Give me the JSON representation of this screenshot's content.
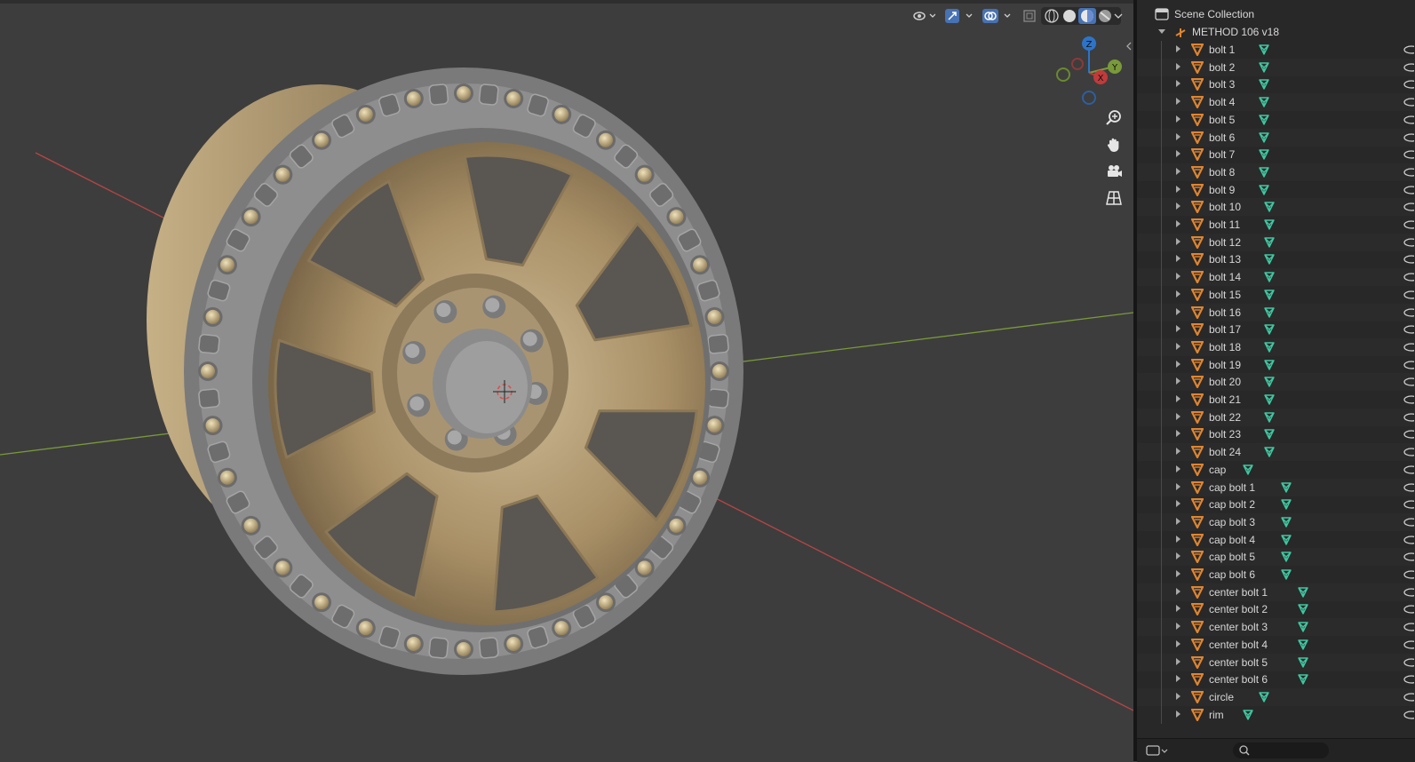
{
  "outliner": {
    "scene_collection_label": "Scene Collection",
    "collection_label": "METHOD 106 v18",
    "items": [
      {
        "label": "bolt 1"
      },
      {
        "label": "bolt 2"
      },
      {
        "label": "bolt 3"
      },
      {
        "label": "bolt 4"
      },
      {
        "label": "bolt 5"
      },
      {
        "label": "bolt 6"
      },
      {
        "label": "bolt 7"
      },
      {
        "label": "bolt 8"
      },
      {
        "label": "bolt 9"
      },
      {
        "label": "bolt 10"
      },
      {
        "label": "bolt 11"
      },
      {
        "label": "bolt 12"
      },
      {
        "label": "bolt 13"
      },
      {
        "label": "bolt 14"
      },
      {
        "label": "bolt 15"
      },
      {
        "label": "bolt 16"
      },
      {
        "label": "bolt 17"
      },
      {
        "label": "bolt 18"
      },
      {
        "label": "bolt 19"
      },
      {
        "label": "bolt 20"
      },
      {
        "label": "bolt 21"
      },
      {
        "label": "bolt 22"
      },
      {
        "label": "bolt 23"
      },
      {
        "label": "bolt 24"
      },
      {
        "label": "cap"
      },
      {
        "label": "cap bolt 1"
      },
      {
        "label": "cap bolt 2"
      },
      {
        "label": "cap bolt 3"
      },
      {
        "label": "cap bolt 4"
      },
      {
        "label": "cap bolt 5"
      },
      {
        "label": "cap bolt 6"
      },
      {
        "label": "center bolt 1"
      },
      {
        "label": "center bolt 2"
      },
      {
        "label": "center bolt 3"
      },
      {
        "label": "center bolt 4"
      },
      {
        "label": "center bolt 5"
      },
      {
        "label": "center bolt 6"
      },
      {
        "label": "circle"
      },
      {
        "label": "rim"
      }
    ]
  },
  "viewport": {
    "gizmo": {
      "z_label": "Z",
      "y_label": "Y",
      "x_label": "X"
    },
    "header_icons": [
      "visibility-icon",
      "gizmo-icon",
      "overlay-icon",
      "xray-icon",
      "wireframe-shading-icon",
      "solid-shading-icon",
      "material-shading-icon",
      "rendered-shading-icon"
    ],
    "nav_icons": [
      "zoom-icon",
      "pan-hand-icon",
      "camera-icon",
      "grid-ortho-icon"
    ]
  },
  "colors": {
    "viewport_bg": "#3d3d3d",
    "outliner_bg": "#282828",
    "object_orange": "#e0852f",
    "mesh_green": "#3fc7a1",
    "axis_x": "#b84545",
    "axis_y": "#7a9a3a",
    "axis_z": "#2d74c9",
    "rim_metal": "#b9a684"
  }
}
